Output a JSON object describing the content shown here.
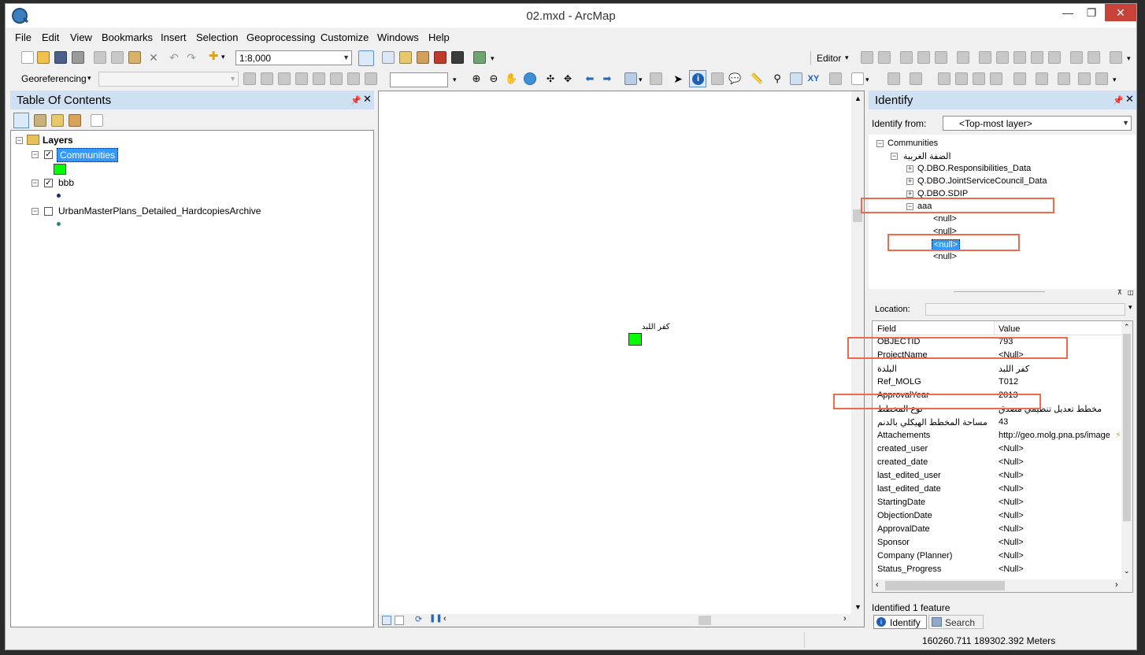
{
  "window": {
    "title": "02.mxd - ArcMap"
  },
  "menu": [
    "File",
    "Edit",
    "View",
    "Bookmarks",
    "Insert",
    "Selection",
    "Geoprocessing",
    "Customize",
    "Windows",
    "Help"
  ],
  "toolbar": {
    "scale_value": "1:8,000",
    "editor_label": "Editor",
    "georef_label": "Georeferencing"
  },
  "toc": {
    "title": "Table Of Contents",
    "root_label": "Layers",
    "layers": [
      {
        "name": "Communities",
        "checked": true,
        "selected": true,
        "symbol_color": "#00ff00"
      },
      {
        "name": "bbb",
        "checked": true,
        "selected": false,
        "symbol_color": "#1f2b6b"
      },
      {
        "name": "UrbanMasterPlans_Detailed_HardcopiesArchive",
        "checked": false,
        "selected": false,
        "symbol_color": "#2a8a6a"
      }
    ]
  },
  "map": {
    "feature_label": "كفر اللبد",
    "feature_color": "#00ff00"
  },
  "identify": {
    "title": "Identify",
    "from_label": "Identify from:",
    "from_value": "<Top-most layer>",
    "tree": {
      "root": "Communities",
      "child": "الضفة الغربية",
      "items": [
        "Q.DBO.Responsibilities_Data",
        "Q.DBO.JointServiceCouncil_Data",
        "Q.DBO.SDIP",
        "aaa"
      ],
      "nulls": [
        "<null>",
        "<null>",
        "<null>",
        "<null>"
      ]
    },
    "location_label": "Location:",
    "table": {
      "headers": {
        "field": "Field",
        "value": "Value"
      },
      "rows": [
        {
          "field": "OBJECTID",
          "value": "793"
        },
        {
          "field": "ProjectName",
          "value": "<Null>"
        },
        {
          "field": "البلدة",
          "value": "كفر اللبد"
        },
        {
          "field": "Ref_MOLG",
          "value": "T012"
        },
        {
          "field": "ApprovalYear",
          "value": "2013"
        },
        {
          "field": "نوع المخطط",
          "value": "مخطط تعديل تنظيمي مصدق"
        },
        {
          "field": "مساحة المخطط الهيكلي بالدنم",
          "value": "43"
        },
        {
          "field": "Attachements",
          "value": "http://geo.molg.pna.ps/image"
        },
        {
          "field": "created_user",
          "value": "<Null>"
        },
        {
          "field": "created_date",
          "value": "<Null>"
        },
        {
          "field": "last_edited_user",
          "value": "<Null>"
        },
        {
          "field": "last_edited_date",
          "value": "<Null>"
        },
        {
          "field": "StartingDate",
          "value": "<Null>"
        },
        {
          "field": "ObjectionDate",
          "value": "<Null>"
        },
        {
          "field": "ApprovalDate",
          "value": "<Null>"
        },
        {
          "field": "Sponsor",
          "value": "<Null>"
        },
        {
          "field": "Company (Planner)",
          "value": "<Null>"
        },
        {
          "field": "Status_Progress",
          "value": "<Null>"
        }
      ]
    },
    "status": "Identified 1 feature",
    "tabs": [
      "Identify",
      "Search"
    ]
  },
  "statusbar": {
    "coords": "160260.711  189302.392 Meters"
  },
  "colors": {
    "highlight": "#3399ff",
    "annotation": "#ee6a4c",
    "panel_header": "#cfe0f2"
  }
}
